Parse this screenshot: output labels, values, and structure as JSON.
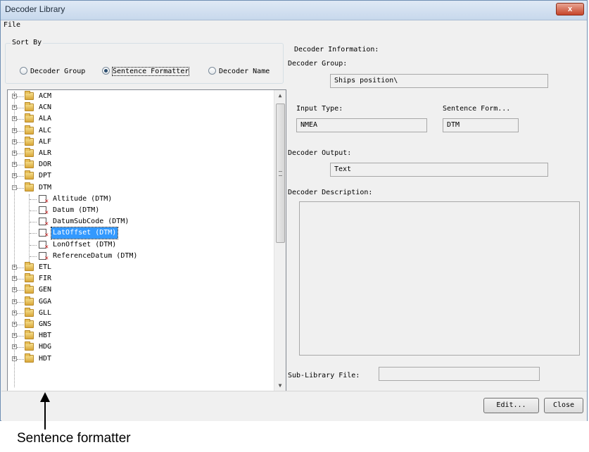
{
  "window": {
    "title": "Decoder Library",
    "close_label": "x"
  },
  "menu": {
    "file": "File"
  },
  "sort_by": {
    "legend": "Sort By",
    "options": [
      {
        "label": "Decoder Group",
        "selected": false
      },
      {
        "label": "Sentence Formatter",
        "selected": true
      },
      {
        "label": "Decoder Name",
        "selected": false
      }
    ]
  },
  "tree": {
    "folders_top": [
      "ACM",
      "ACN",
      "ALA",
      "ALC",
      "ALF",
      "ALR",
      "DOR",
      "DPT"
    ],
    "expanded_folder": "DTM",
    "children": [
      "Altitude (DTM)",
      "Datum (DTM)",
      "DatumSubCode (DTM)",
      "LatOffset (DTM)",
      "LonOffset (DTM)",
      "ReferenceDatum (DTM)"
    ],
    "selected_child": "LatOffset (DTM)",
    "folders_bottom": [
      "ETL",
      "FIR",
      "GEN",
      "GGA",
      "GLL",
      "GNS",
      "HBT",
      "HDG",
      "HDT"
    ]
  },
  "info": {
    "legend": "Decoder Information:",
    "group_label": "Decoder Group:",
    "group_value": "Ships position\\",
    "input_type_label": "Input Type:",
    "input_type_value": "NMEA",
    "sentence_form_label": "Sentence Form...",
    "sentence_form_value": "DTM",
    "output_label": "Decoder Output:",
    "output_value": "Text",
    "description_label": "Decoder Description:",
    "description_value": "",
    "sublib_label": "Sub-Library File:",
    "sublib_value": ""
  },
  "buttons": {
    "edit": "Edit...",
    "close": "Close"
  },
  "annotation": {
    "caption": "Sentence formatter"
  }
}
